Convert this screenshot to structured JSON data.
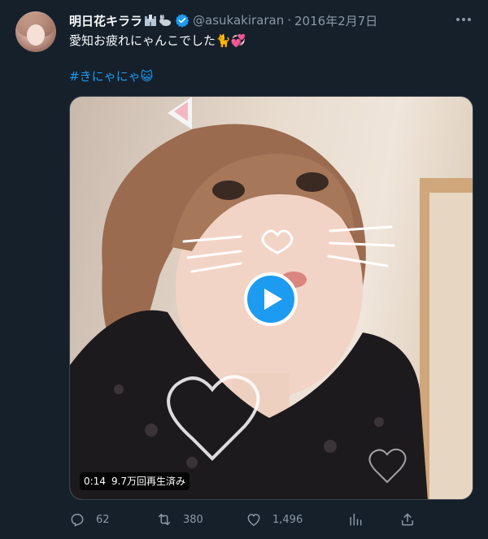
{
  "tweet": {
    "author_name": "明日花キララ",
    "author_emojis": [
      "castle",
      "rabbit"
    ],
    "handle": "@asukakiraran",
    "separator": "·",
    "date": "2016年2月7日",
    "text_line1": "愛知お疲れにゃんこでした🐈💞",
    "text_line2": "#きにゃにゃ😺"
  },
  "media": {
    "duration": "0:14",
    "views": "9.7万回再生済み"
  },
  "actions": {
    "reply_count": "62",
    "retweet_count": "380",
    "like_count": "1,496"
  },
  "colors": {
    "background": "#15202b",
    "accent": "#1d9bf0",
    "muted": "#8b98a5",
    "text": "#f7f9f9"
  },
  "icons": [
    "verified-icon",
    "more-icon",
    "play-icon",
    "reply-icon",
    "retweet-icon",
    "like-icon",
    "analytics-icon",
    "share-icon"
  ]
}
